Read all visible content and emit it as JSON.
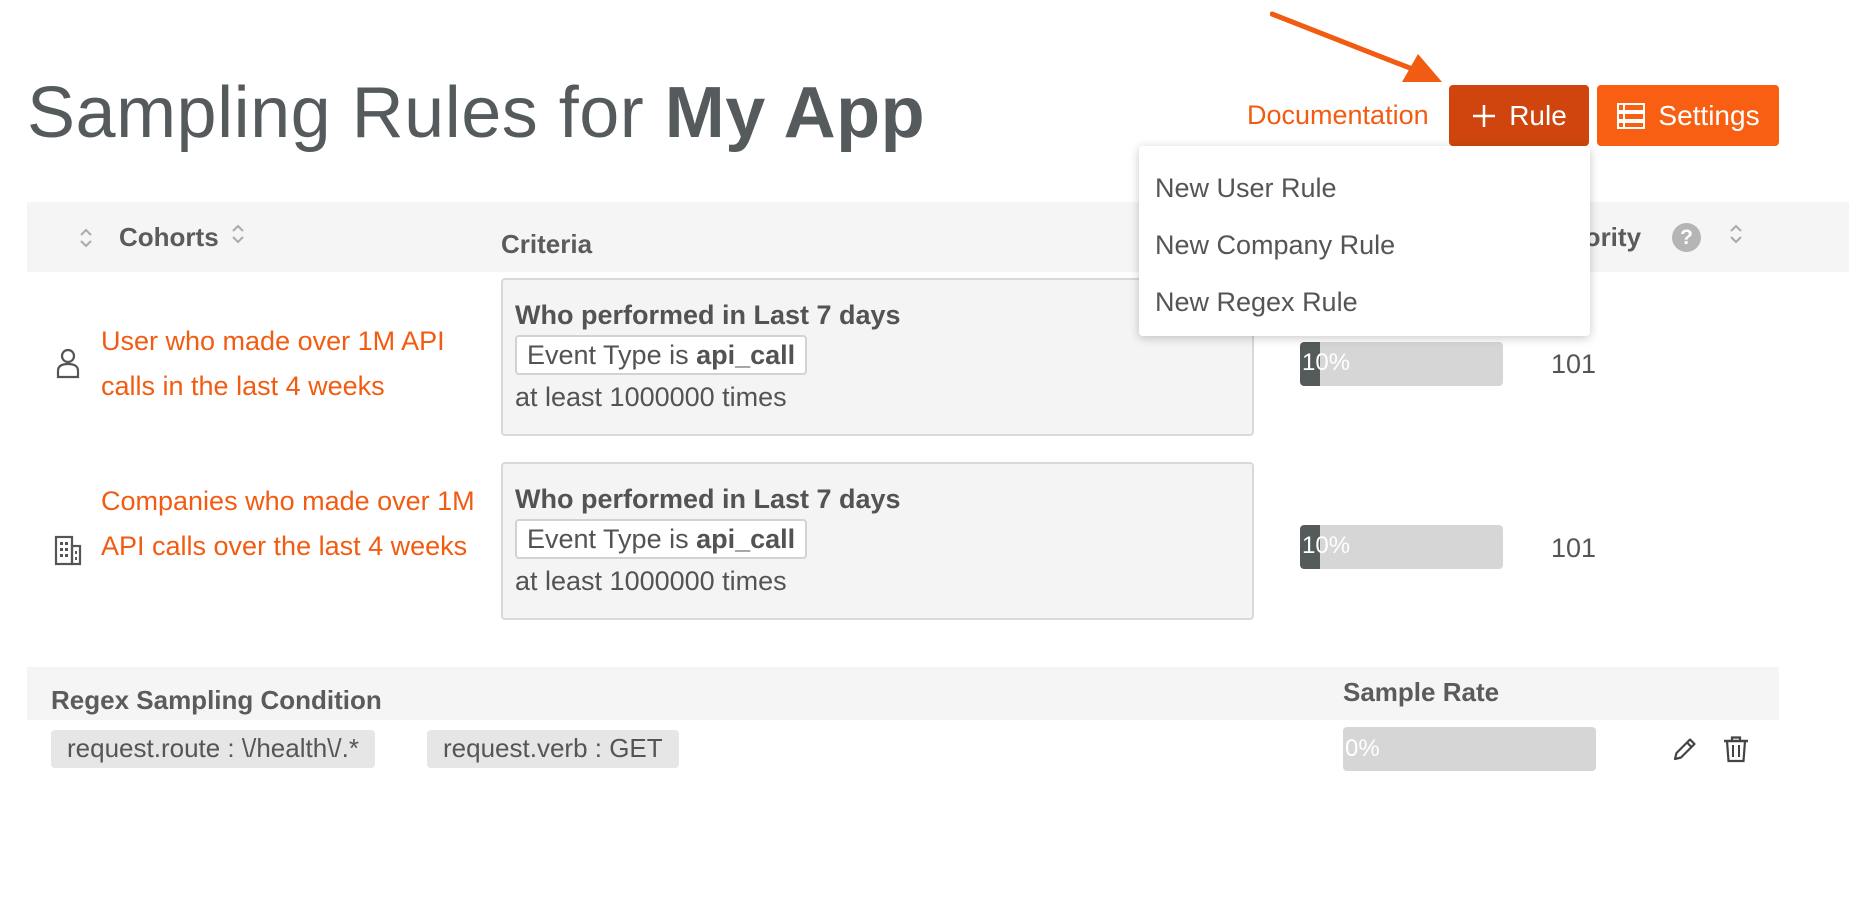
{
  "header": {
    "title_prefix": "Sampling Rules for",
    "app_name": "My App",
    "documentation_label": "Documentation",
    "add_rule_label": "Rule",
    "settings_label": "Settings"
  },
  "table": {
    "columns": {
      "cohorts": "Cohorts",
      "criteria": "Criteria",
      "priority": "Priority"
    },
    "help_icon_text": "?",
    "rows": [
      {
        "icon": "user-icon",
        "name": "User who made over 1M API calls in the last 4 weeks",
        "criteria_title": "Who performed in Last 7 days",
        "event_prefix": "Event Type is",
        "event_name": "api_call",
        "criteria_times": "at least 1000000 times",
        "sample_rate": "10%",
        "sample_rate_value": 0.1,
        "priority": "101"
      },
      {
        "icon": "building-icon",
        "name": "Companies who made over 1M API calls over the last 4 weeks",
        "criteria_title": "Who performed in Last 7 days",
        "event_prefix": "Event Type is",
        "event_name": "api_call",
        "criteria_times": "at least 1000000 times",
        "sample_rate": "10%",
        "sample_rate_value": 0.1,
        "priority": "101"
      }
    ]
  },
  "regex": {
    "condition_header": "Regex Sampling Condition",
    "rate_header": "Sample Rate",
    "conditions": [
      "request.route : \\/health\\/.*",
      "request.verb : GET"
    ],
    "sample_rate": "0%",
    "sample_rate_value": 0
  },
  "dropdown": {
    "items": [
      "New User Rule",
      "New Company Rule",
      "New Regex Rule"
    ]
  },
  "colors": {
    "accent": "#f25c12",
    "rule_button": "#d0450e",
    "settings_button": "#f85f13",
    "rate_fill": "#555b5b"
  }
}
